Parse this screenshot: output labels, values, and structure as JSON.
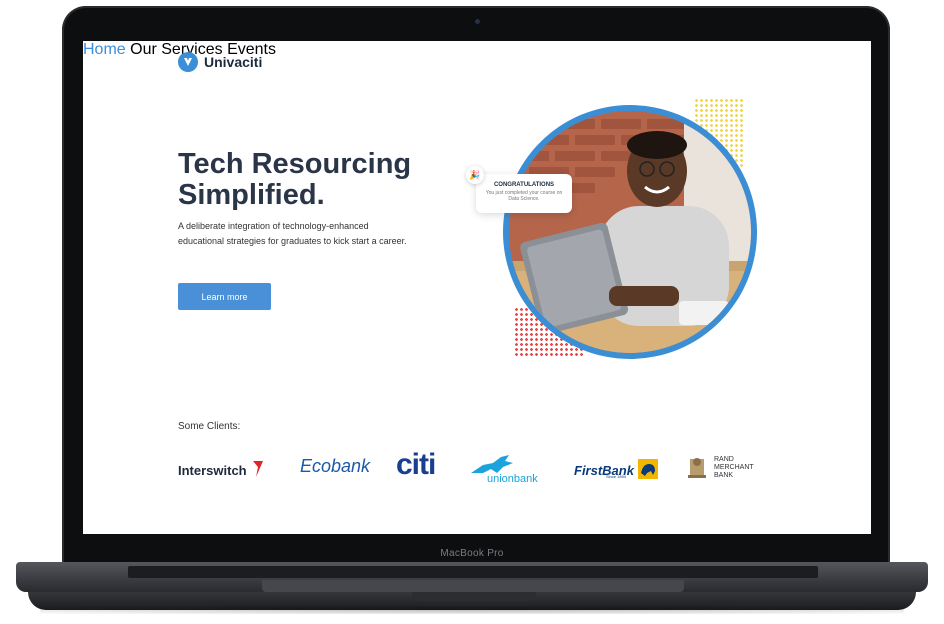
{
  "device": {
    "label": "MacBook Pro"
  },
  "brand": {
    "name": "Univaciti",
    "accent": "#3a8fd8"
  },
  "nav": {
    "items": [
      "Home",
      "Our Services",
      "Events"
    ],
    "active": "Home"
  },
  "hero": {
    "title_line1": "Tech Resourcing",
    "title_line2": "Simplified.",
    "subtitle": "A deliberate integration of technology-enhanced educational strategies for graduates to kick start a career.",
    "cta_label": "Learn more"
  },
  "notification": {
    "title": "CONGRATULATIONS",
    "body": "You just completed your course on Data Science.",
    "icon": "party-popper-icon"
  },
  "clients": {
    "label": "Some Clients:",
    "items": [
      "Interswitch",
      "Ecobank",
      "citi",
      "unionbank",
      "FirstBank",
      "Since 1894",
      "RAND",
      "MERCHANT",
      "BANK"
    ]
  },
  "colors": {
    "primary": "#4a90d9",
    "dots_yellow": "#f2d64b",
    "dots_red": "#e64b4b",
    "heading": "#2b3548"
  }
}
